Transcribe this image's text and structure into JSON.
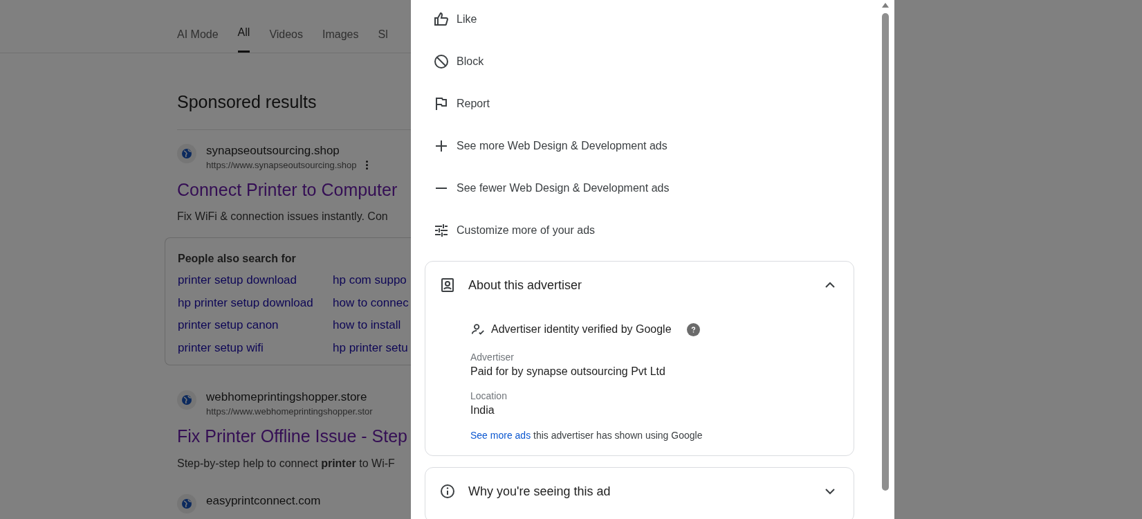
{
  "tabs": [
    {
      "label": "AI Mode",
      "selected": false
    },
    {
      "label": "All",
      "selected": true
    },
    {
      "label": "Videos",
      "selected": false
    },
    {
      "label": "Images",
      "selected": false
    },
    {
      "label": "Sl",
      "selected": false
    }
  ],
  "heading": "Sponsored results",
  "results": [
    {
      "site": "synapseoutsourcing.shop",
      "url": "https://www.synapseoutsourcing.shop",
      "title": "Connect Printer to Computer",
      "description": "Fix WiFi & connection issues instantly. Con"
    },
    {
      "site": "webhomeprintingshopper.store",
      "url": "https://www.webhomeprintingshopper.stor",
      "title": "Fix Printer Offline Issue - Step",
      "description": "Step-by-step help to connect **printer** to Wi-F"
    },
    {
      "site": "easyprintconnect.com"
    }
  ],
  "related_searches": {
    "title": "People also search for",
    "items": [
      "printer setup download",
      "hp com suppo",
      "hp printer setup download",
      "how to connec",
      "printer setup canon",
      "how to install",
      "printer setup wifi",
      "hp printer setu"
    ]
  },
  "menu": [
    {
      "kind": "like",
      "label": "Like"
    },
    {
      "kind": "block",
      "label": "Block"
    },
    {
      "kind": "report",
      "label": "Report"
    },
    {
      "kind": "more",
      "label": "See more Web Design & Development ads"
    },
    {
      "kind": "fewer",
      "label": "See fewer Web Design & Development ads"
    },
    {
      "kind": "customize",
      "label": "Customize more of your ads"
    }
  ],
  "about": {
    "title": "About this advertiser",
    "expanded": true,
    "verified": "Advertiser identity verified by Google",
    "fields": [
      {
        "label": "Advertiser",
        "value": "Paid for by synapse outsourcing Pvt Ltd"
      },
      {
        "label": "Location",
        "value": "India"
      }
    ],
    "link": "See more ads",
    "footer": "this advertiser has shown using Google"
  },
  "why": {
    "title": "Why you're seeing this ad",
    "expanded": false
  }
}
